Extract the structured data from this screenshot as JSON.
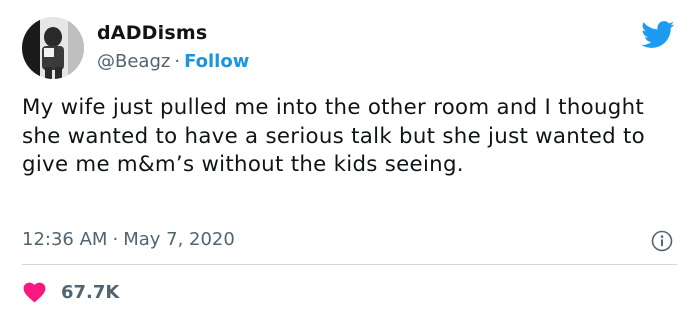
{
  "author": {
    "display_name": "dADDisms",
    "handle": "@Beagz",
    "separator": "·",
    "follow_label": "Follow"
  },
  "tweet": {
    "text": "My wife just pulled me into the other room and I thought she wanted to have a serious talk but she just wanted to give me m&m’s without the kids seeing.",
    "time": "12:36 AM",
    "separator": "·",
    "date": "May 7, 2020"
  },
  "engagement": {
    "like_count": "67.7K"
  },
  "colors": {
    "accent": "#1b95e0",
    "heart": "#f91880",
    "secondary_text": "#536471"
  },
  "icons": [
    "avatar",
    "twitter-bird-icon",
    "info-icon",
    "heart-icon"
  ]
}
